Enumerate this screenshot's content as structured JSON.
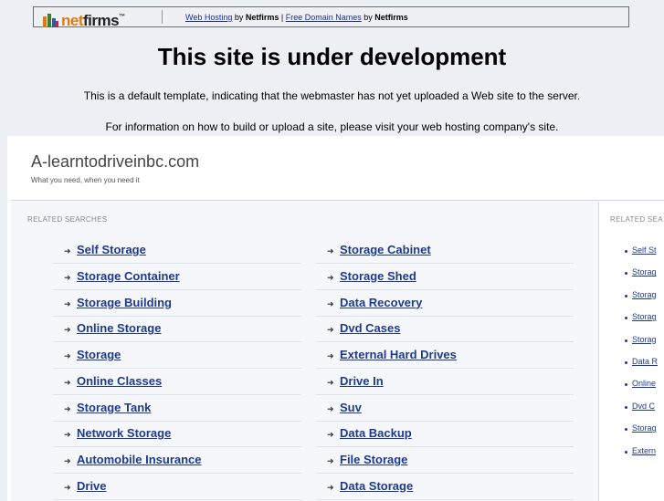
{
  "banner": {
    "logo_net": "net",
    "logo_firms": "firms",
    "web_hosting_link": "Web Hosting",
    "by1": " by ",
    "brand1": "Netfirms",
    "divider": " | ",
    "domain_link": "Free Domain Names",
    "by2": " by ",
    "brand2": "Netfirms"
  },
  "heading": "This site is under development",
  "para1": "This is a default template, indicating that the webmaster has not yet uploaded a Web site to the server.",
  "para2": "For information on how to build or upload a site, please visit your web hosting company's site.",
  "site": {
    "title": "A-learntodriveinbc.com",
    "tagline": "What you need, when you need it",
    "related_label": "RELATED SEARCHES",
    "side_label": "RELATED SEA",
    "left_links": [
      "Self Storage",
      "Storage Container",
      "Storage Building",
      "Online Storage",
      "Storage",
      "Online Classes",
      "Storage Tank",
      "Network Storage",
      "Automobile Insurance",
      "Drive"
    ],
    "right_links": [
      "Storage Cabinet",
      "Storage Shed",
      "Data Recovery",
      "Dvd Cases",
      "External Hard Drives",
      "Drive In",
      "Suv",
      "Data Backup",
      "File Storage",
      "Data Storage"
    ],
    "side_links": [
      "Self St",
      "Storag",
      "Storag",
      "Storag",
      "Storag",
      "Data R",
      "Online",
      "Dvd C",
      "Storag",
      "Extern"
    ]
  },
  "colors": {
    "link": "#1e3a8f",
    "logo_orange": "#e07a10",
    "background": "#eceff4"
  }
}
